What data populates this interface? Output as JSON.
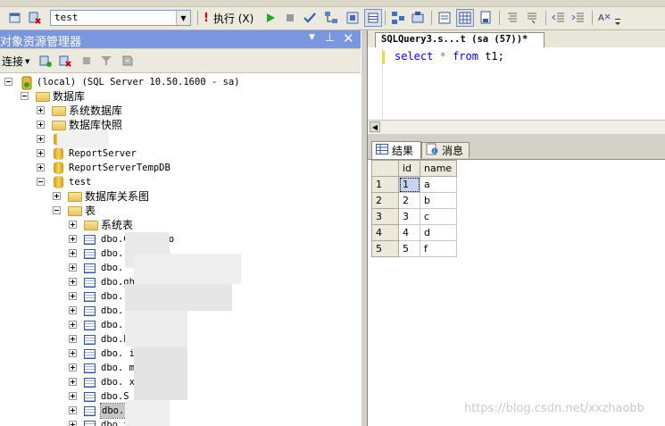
{
  "toolbar": {
    "database": "test",
    "execute_label": "执行 (X)"
  },
  "object_explorer": {
    "title": "对象资源管理器",
    "connect_label": "连接",
    "tree": [
      {
        "depth": 0,
        "expander": "minus",
        "icon": "server",
        "label": "(local) (SQL Server 10.50.1600 - sa)"
      },
      {
        "depth": 1,
        "expander": "minus",
        "icon": "folder",
        "label": "数据库"
      },
      {
        "depth": 2,
        "expander": "plus",
        "icon": "folder",
        "label": "系统数据库"
      },
      {
        "depth": 2,
        "expander": "plus",
        "icon": "folder",
        "label": "数据库快照"
      },
      {
        "depth": 2,
        "expander": "plus",
        "icon": "database",
        "label": ""
      },
      {
        "depth": 2,
        "expander": "plus",
        "icon": "database",
        "label": "ReportServer"
      },
      {
        "depth": 2,
        "expander": "plus",
        "icon": "database",
        "label": "ReportServerTempDB"
      },
      {
        "depth": 2,
        "expander": "minus",
        "icon": "database",
        "label": "test"
      },
      {
        "depth": 3,
        "expander": "plus",
        "icon": "folder",
        "label": "数据库关系图"
      },
      {
        "depth": 3,
        "expander": "minus",
        "icon": "folder",
        "label": "表"
      },
      {
        "depth": 4,
        "expander": "plus",
        "icon": "folder",
        "label": "系统表"
      },
      {
        "depth": 4,
        "expander": "plus",
        "icon": "table",
        "label": "dbo.ClassInfo"
      },
      {
        "depth": 4,
        "expander": "plus",
        "icon": "table",
        "label": "dbo."
      },
      {
        "depth": 4,
        "expander": "plus",
        "icon": "table",
        "label": "dbo."
      },
      {
        "depth": 4,
        "expander": "plus",
        "icon": "table",
        "label": "dbo.ght"
      },
      {
        "depth": 4,
        "expander": "plus",
        "icon": "table",
        "label": "dbo."
      },
      {
        "depth": 4,
        "expander": "plus",
        "icon": "table",
        "label": "dbo."
      },
      {
        "depth": 4,
        "expander": "plus",
        "icon": "table",
        "label": "dbo.    SD"
      },
      {
        "depth": 4,
        "expander": "plus",
        "icon": "table",
        "label": "dbo.E"
      },
      {
        "depth": 4,
        "expander": "plus",
        "icon": "table",
        "label": "dbo.   ightz    mp1"
      },
      {
        "depth": 4,
        "expander": "plus",
        "icon": "table",
        "label": "dbo.            mp2"
      },
      {
        "depth": 4,
        "expander": "plus",
        "icon": "table",
        "label": "dbo.           xmp2"
      },
      {
        "depth": 4,
        "expander": "plus",
        "icon": "table",
        "label": "dbo.S"
      },
      {
        "depth": 4,
        "expander": "plus",
        "icon": "table",
        "label": "dbo.t1",
        "selected": true
      },
      {
        "depth": 4,
        "expander": "plus",
        "icon": "table",
        "label": "dbo.test1"
      }
    ]
  },
  "query_tab": {
    "title": "SQLQuery3.s...t (sa (57))*"
  },
  "editor": {
    "keyword_select": "select",
    "star": "*",
    "keyword_from": "from",
    "table": "t1;"
  },
  "results": {
    "tab_results": "结果",
    "tab_messages": "消息",
    "columns": [
      "id",
      "name"
    ],
    "rows": [
      {
        "rownum": "1",
        "id": "1",
        "name": "a"
      },
      {
        "rownum": "2",
        "id": "2",
        "name": "b"
      },
      {
        "rownum": "3",
        "id": "3",
        "name": "c"
      },
      {
        "rownum": "4",
        "id": "4",
        "name": "d"
      },
      {
        "rownum": "5",
        "id": "5",
        "name": "f"
      }
    ]
  },
  "watermark": "https://blog.csdn.net/xxzhaobb",
  "colors": {
    "panel_title": "#7a96df",
    "keyword": "#0000ff",
    "selection": "#c6c6c6"
  }
}
